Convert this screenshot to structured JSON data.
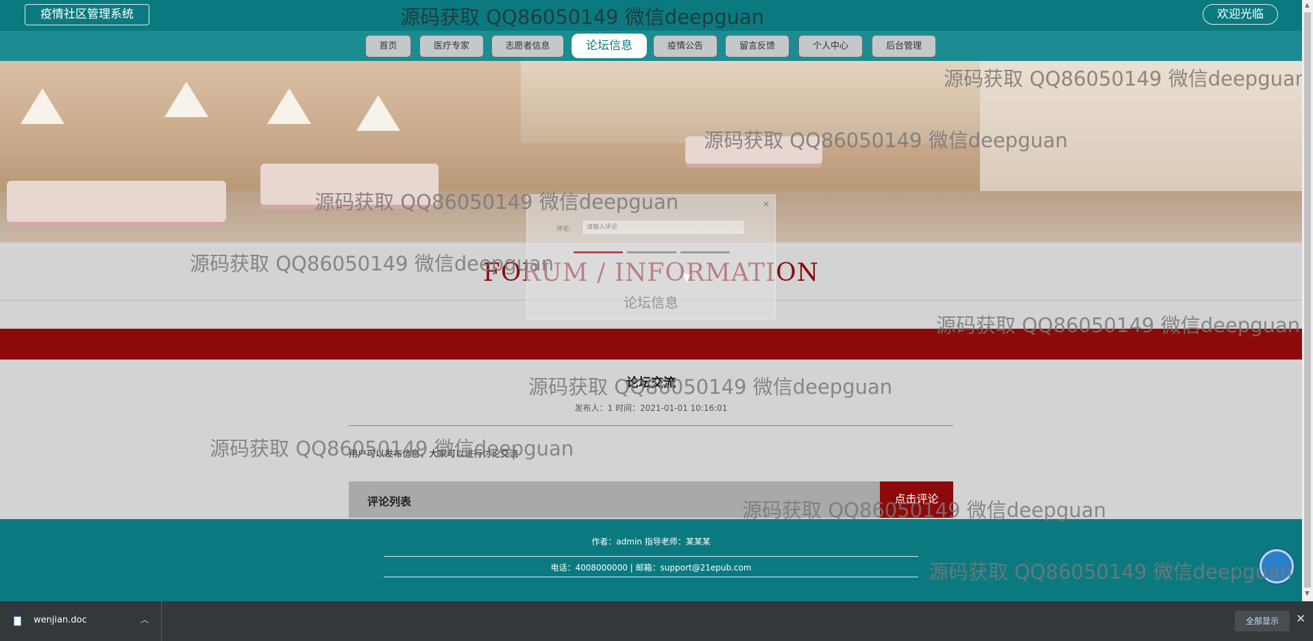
{
  "header": {
    "title": "疫情社区管理系统",
    "welcome": "欢迎光临"
  },
  "nav": {
    "items": [
      "首页",
      "医疗专家",
      "志愿者信息",
      "论坛信息",
      "疫情公告",
      "留言反馈",
      "个人中心",
      "后台管理"
    ],
    "active_index": 3
  },
  "section": {
    "title_en": "FORUM / INFORMATION",
    "title_cn": "论坛信息"
  },
  "post": {
    "title": "论坛交流",
    "meta": "发布人：1 时间：2021-01-01 10:16:01",
    "body": "用户可以发布信息，大家可以进行讨论交流"
  },
  "comments": {
    "label": "评论列表",
    "button": "点击评论"
  },
  "modal": {
    "close": "×",
    "label": "评论:",
    "placeholder": "请输入评论"
  },
  "footer": {
    "line1": "作者：admin 指导老师：某某某",
    "line2": "电话：4008000000 | 邮箱：support@21epub.com"
  },
  "watermark": "源码获取 QQ86050149 微信deepguan",
  "downloads": {
    "file": "wenjian.doc",
    "show_all": "全部显示",
    "close": "✕"
  },
  "colors": {
    "teal": "#0b7a80",
    "dark_red": "#8e0a0a",
    "forum_title": "#8b0b0b"
  },
  "icons": [
    "doc-file-icon",
    "chevron-up-icon",
    "close-icon",
    "back-to-top-icon"
  ]
}
